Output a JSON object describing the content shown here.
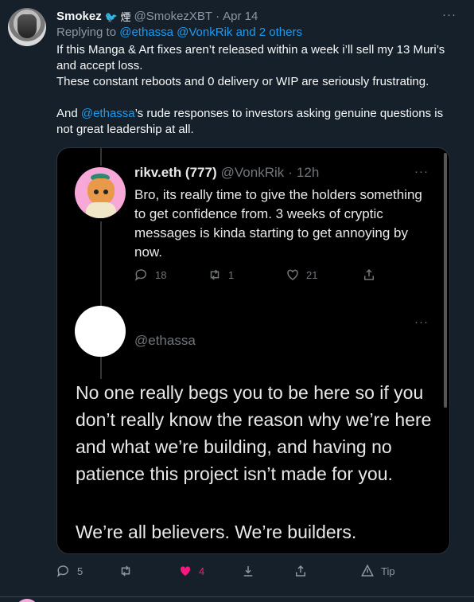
{
  "tweet": {
    "name": "Smokez",
    "badge": "🐦 煙",
    "handle": "@SmokezXBT",
    "dot": "·",
    "time": "Apr 14",
    "more": "···",
    "replying_prefix": "Replying to",
    "replying_links": "@ethassa @VonkRik and 2 others",
    "body": {
      "line1": "If this Manga & Art fixes aren’t released within a week i’ll sell my 13 Muri’s and accept loss.",
      "line2": "These constant reboots and 0 delivery or WIP are seriously frustrating.",
      "line3_mention": "@ethassa",
      "line3_rest": "’s rude responses to investors asking genuine questions is not great leadership at all.",
      "line3_prefix": "And "
    },
    "actions": {
      "replies": "5",
      "retweets": "",
      "likes": "4",
      "tip": "Tip"
    }
  },
  "screenshot": {
    "reply_tweet": {
      "name": "rikv.eth (777)",
      "handle": "@VonkRik",
      "dot": "·",
      "time": "12h",
      "more": "···",
      "text": "Bro, its really time to give the holders something to get confidence from. 3 weeks of cryptic messages is kinda starting to get annoying by now.",
      "replies": "18",
      "retweets": "1",
      "likes": "21"
    },
    "response_tweet": {
      "handle": "@ethassa",
      "more": "···",
      "text1": "No one really begs you to be here so if you don’t really know the reason why we’re here and what we’re building, and having no patience this project isn’t made for you.",
      "text2": "We’re all believers. We’re builders."
    }
  },
  "colors": {
    "background": "#15202b",
    "link": "#1d9bf0",
    "like_active": "#f91880",
    "muted": "#8b98a5"
  }
}
